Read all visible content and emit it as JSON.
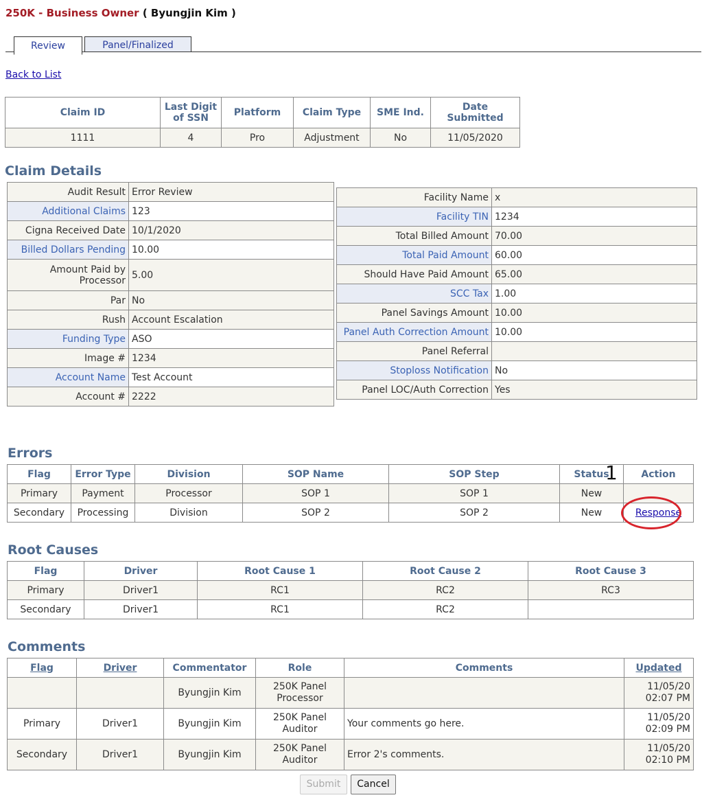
{
  "header": {
    "role_prefix": "250K",
    "separator": " - ",
    "role_name": "Business Owner",
    "user": "( Byungjin Kim )"
  },
  "tabs": {
    "review": "Review",
    "panel": "Panel/Finalized"
  },
  "back_link": "Back to List",
  "claim_summary": {
    "headers": [
      "Claim ID",
      "Last Digit of SSN",
      "Platform",
      "Claim Type",
      "SME Ind.",
      "Date Submitted"
    ],
    "values": [
      "1111",
      "4",
      "Pro",
      "Adjustment",
      "No",
      "11/05/2020"
    ]
  },
  "claim_details": {
    "title": "Claim Details",
    "left": [
      {
        "label": "Audit Result",
        "value": "Error Review"
      },
      {
        "label": "Additional Claims",
        "value": "123"
      },
      {
        "label": "Cigna Received Date",
        "value": "10/1/2020"
      },
      {
        "label": "Billed Dollars Pending",
        "value": "10.00"
      },
      {
        "label": "Amount Paid by Processor",
        "value": "5.00"
      },
      {
        "label": "Par",
        "value": "No"
      },
      {
        "label": "Rush",
        "value": "Account Escalation"
      },
      {
        "label": "Funding Type",
        "value": "ASO"
      },
      {
        "label": "Image #",
        "value": "1234"
      },
      {
        "label": "Account Name",
        "value": "Test Account"
      },
      {
        "label": "Account #",
        "value": "2222"
      }
    ],
    "right": [
      {
        "label": "Facility Name",
        "value": "x"
      },
      {
        "label": "Facility TIN",
        "value": "1234"
      },
      {
        "label": "Total Billed Amount",
        "value": "70.00"
      },
      {
        "label": "Total Paid Amount",
        "value": "60.00"
      },
      {
        "label": "Should Have Paid Amount",
        "value": "65.00"
      },
      {
        "label": "SCC Tax",
        "value": "1.00"
      },
      {
        "label": "Panel Savings Amount",
        "value": "10.00"
      },
      {
        "label": "Panel Auth Correction Amount",
        "value": "10.00"
      },
      {
        "label": "Panel Referral",
        "value": ""
      },
      {
        "label": "Stoploss Notification",
        "value": "No"
      },
      {
        "label": "Panel LOC/Auth Correction",
        "value": "Yes"
      }
    ]
  },
  "errors": {
    "title": "Errors",
    "headers": [
      "Flag",
      "Error Type",
      "Division",
      "SOP Name",
      "SOP Step",
      "Status",
      "Action"
    ],
    "rows": [
      {
        "flag": "Primary",
        "error_type": "Payment",
        "division": "Processor",
        "sop_name": "SOP 1",
        "sop_step": "SOP 1",
        "status": "New",
        "action": ""
      },
      {
        "flag": "Secondary",
        "error_type": "Processing",
        "division": "Division",
        "sop_name": "SOP 2",
        "sop_step": "SOP 2",
        "status": "New",
        "action": "Response"
      }
    ],
    "marker": "1"
  },
  "root_causes": {
    "title": "Root Causes",
    "headers": [
      "Flag",
      "Driver",
      "Root Cause 1",
      "Root Cause 2",
      "Root Cause 3"
    ],
    "rows": [
      [
        "Primary",
        "Driver1",
        "RC1",
        "RC2",
        "RC3"
      ],
      [
        "Secondary",
        "Driver1",
        "RC1",
        "RC2",
        ""
      ]
    ]
  },
  "comments": {
    "title": "Comments",
    "headers": [
      "Flag",
      "Driver",
      "Commentator",
      "Role",
      "Comments",
      "Updated"
    ],
    "rows": [
      {
        "flag": "",
        "driver": "",
        "commentator": "Byungjin Kim",
        "role1": "250K Panel",
        "role2": "Processor",
        "comment": "",
        "date": "11/05/20",
        "time": "02:07 PM"
      },
      {
        "flag": "Primary",
        "driver": "Driver1",
        "commentator": "Byungjin Kim",
        "role1": "250K Panel",
        "role2": "Auditor",
        "comment": "Your comments go here.",
        "date": "11/05/20",
        "time": "02:09 PM"
      },
      {
        "flag": "Secondary",
        "driver": "Driver1",
        "commentator": "Byungjin Kim",
        "role1": "250K Panel",
        "role2": "Auditor",
        "comment": "Error 2's comments.",
        "date": "11/05/20",
        "time": "02:10 PM"
      }
    ]
  },
  "buttons": {
    "submit": "Submit",
    "cancel": "Cancel"
  },
  "colors": {
    "accent_red": "#a31c25",
    "header_blue": "#4f6b8f",
    "link_blue": "#1a0dab",
    "highlight_circle": "#d8242c",
    "row_beige": "#f5f4ee"
  }
}
